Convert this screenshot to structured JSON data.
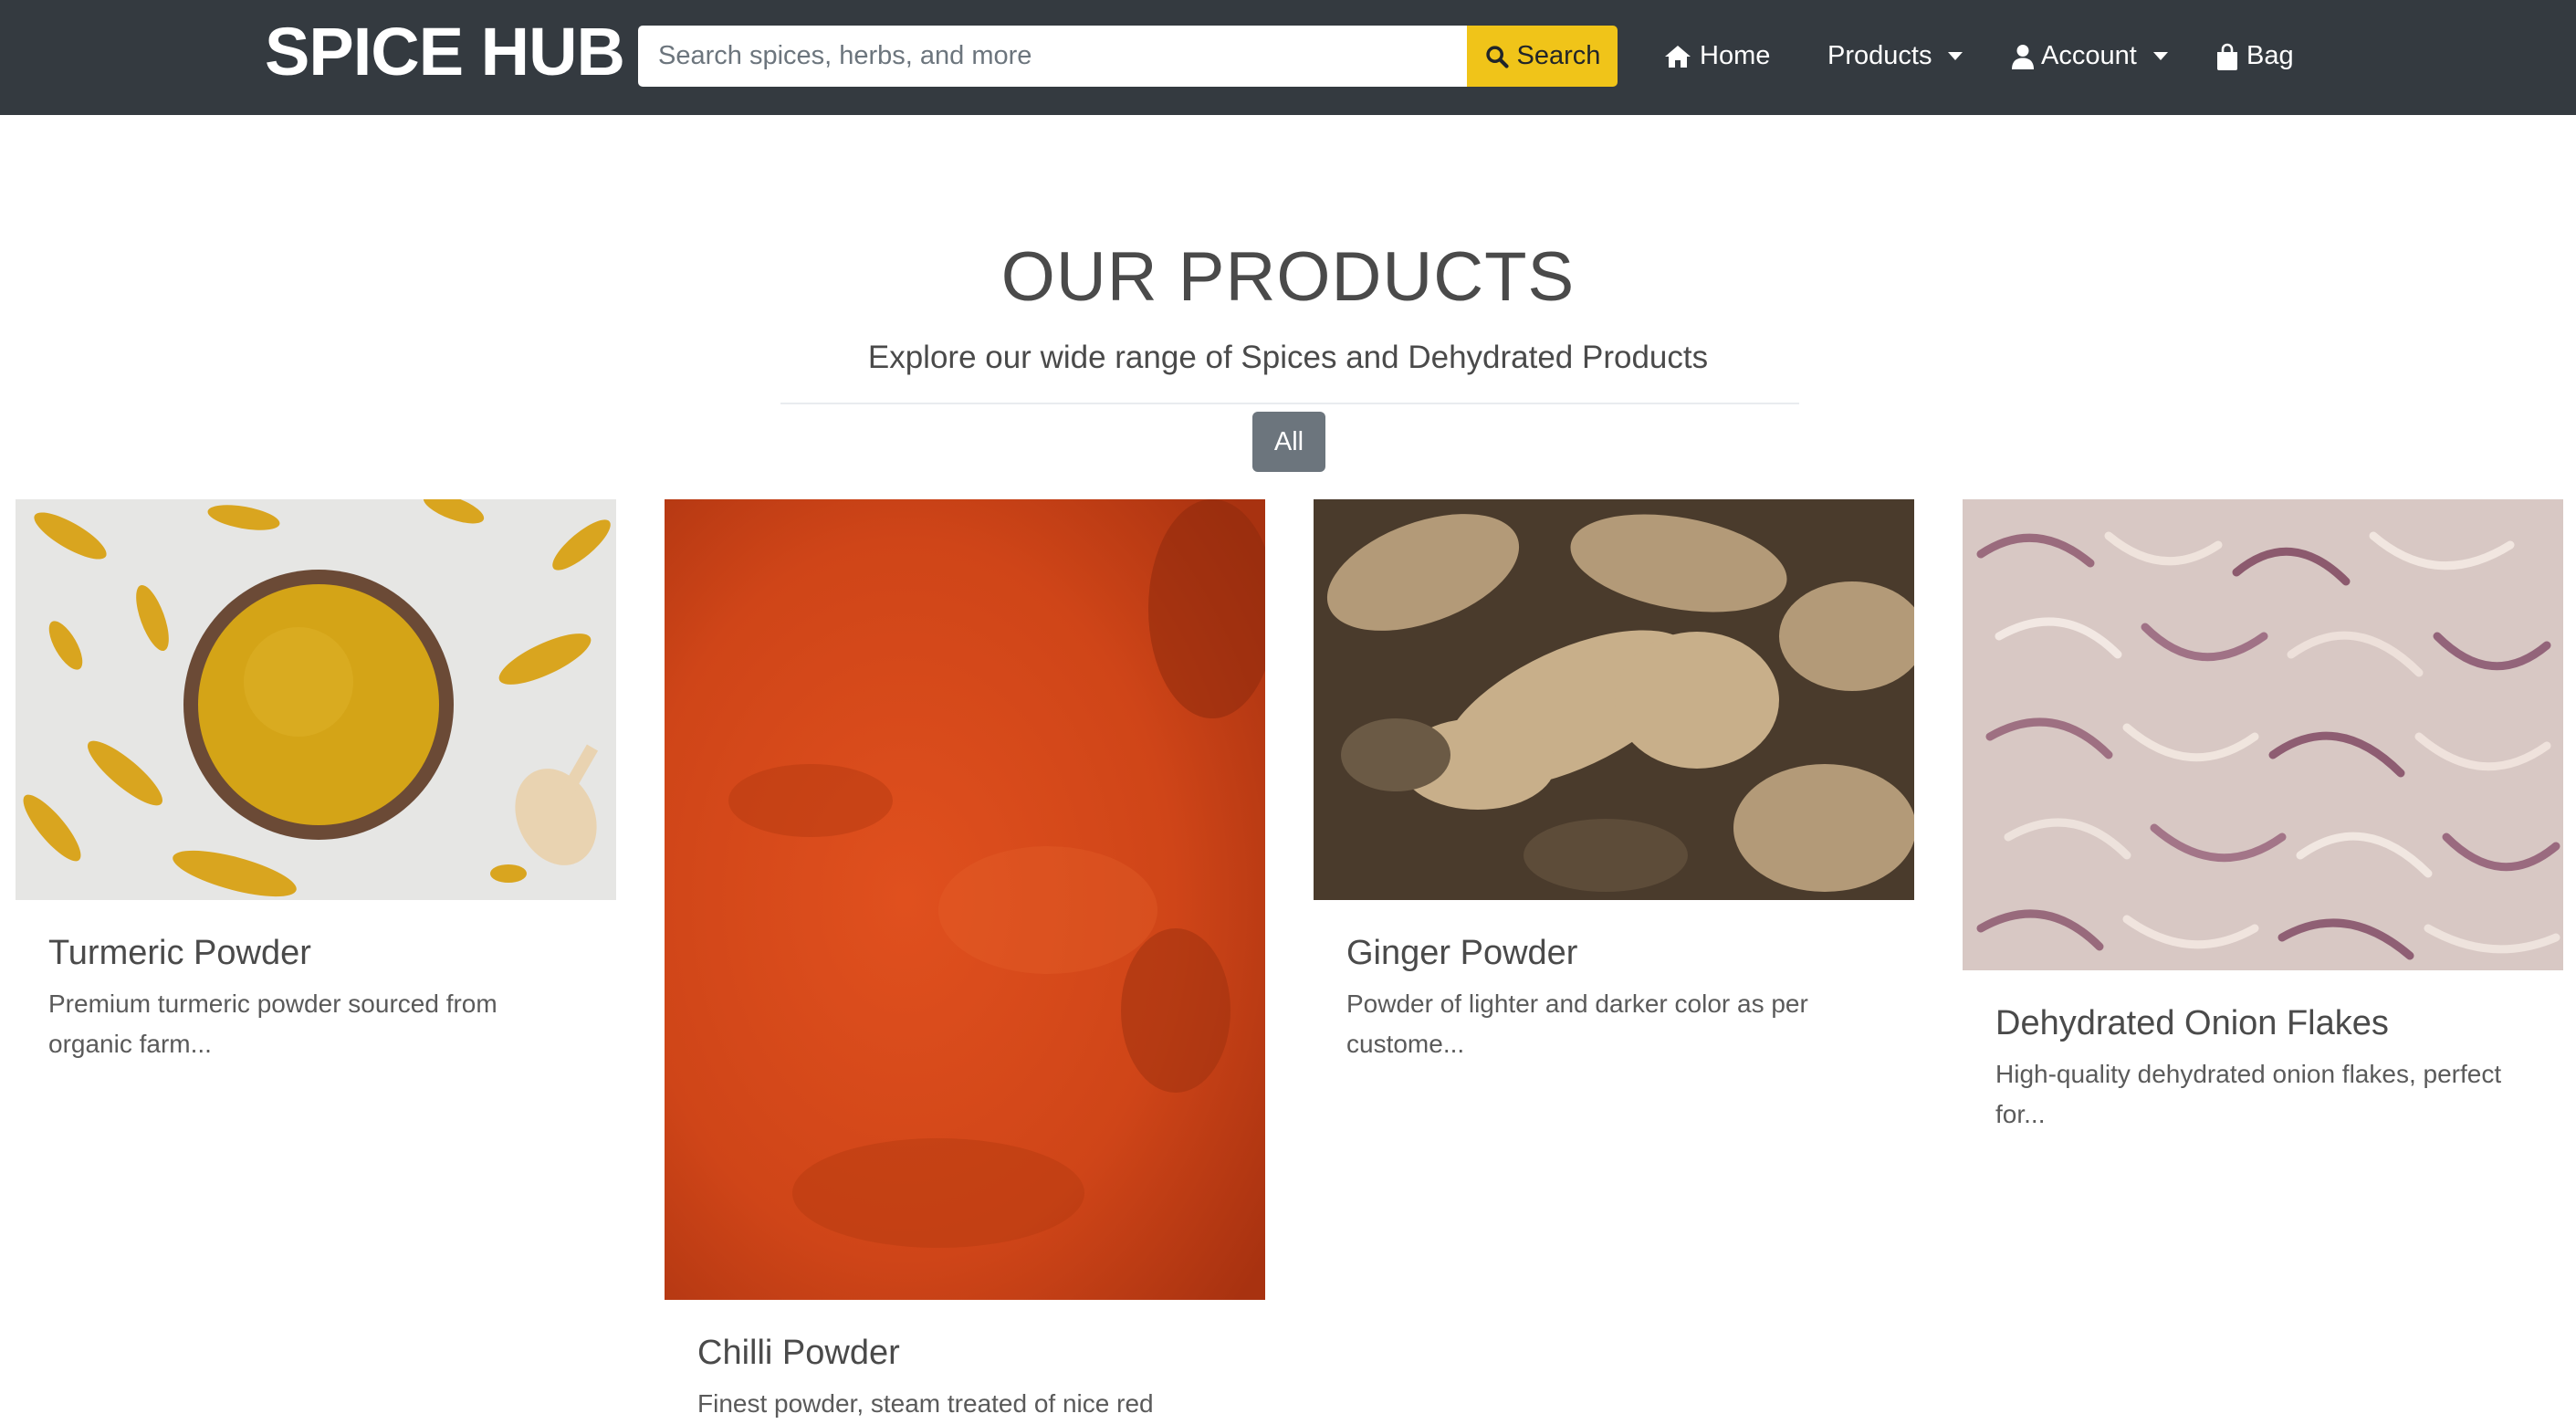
{
  "navbar": {
    "brand": "SPICE HUB",
    "search_placeholder": "Search spices, herbs, and more",
    "search_label": "Search",
    "home_label": "Home",
    "products_label": "Products",
    "account_label": "Account",
    "bag_label": "Bag",
    "icons": [
      "search-icon",
      "home-icon",
      "user-icon",
      "shopping-bag-icon"
    ]
  },
  "header": {
    "title": "OUR PRODUCTS",
    "subtitle": "Explore our wide range of Spices and Dehydrated Products",
    "filter_all": "All"
  },
  "products": [
    {
      "name": "Turmeric Powder",
      "description": "Premium turmeric powder sourced from organic farm..."
    },
    {
      "name": "Chilli Powder",
      "description": "Finest powder, steam treated of nice red color,"
    },
    {
      "name": "Ginger Powder",
      "description": "Powder of lighter and darker color as per custome..."
    },
    {
      "name": "Dehydrated Onion Flakes",
      "description": "High-quality dehydrated onion flakes, perfect for..."
    }
  ],
  "colors": {
    "navbar_bg": "#343a40",
    "search_button": "#f0c419",
    "filter_button": "#6c757d"
  }
}
